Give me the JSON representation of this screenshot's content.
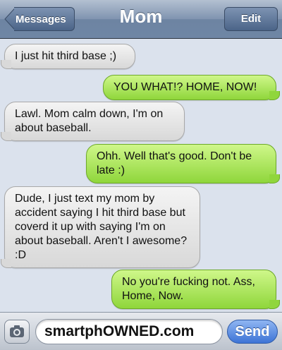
{
  "header": {
    "title": "Mom",
    "back_label": "Messages",
    "edit_label": "Edit"
  },
  "messages": [
    {
      "direction": "incoming",
      "text": "I just hit third base ;)"
    },
    {
      "direction": "outgoing",
      "text": "YOU WHAT!? HOME, NOW!"
    },
    {
      "direction": "incoming",
      "text": "Lawl. Mom calm down, I'm on about baseball."
    },
    {
      "direction": "outgoing",
      "text": "Ohh. Well that's good. Don't be late :)"
    },
    {
      "direction": "incoming",
      "text": "Dude, I just text my mom by accident saying I hit third base but coverd it up with saying I'm on about baseball. Aren't I awesome? :D"
    },
    {
      "direction": "outgoing",
      "text": "No you're fucking not. Ass, Home, Now."
    }
  ],
  "input": {
    "value": "smartphOWNED.com",
    "send_label": "Send",
    "camera_icon": "camera-icon"
  },
  "colors": {
    "incoming_bubble": "#e6e6e6",
    "outgoing_bubble": "#a8e55c",
    "navbar": "#7488a6",
    "send_button": "#3d74d6"
  }
}
